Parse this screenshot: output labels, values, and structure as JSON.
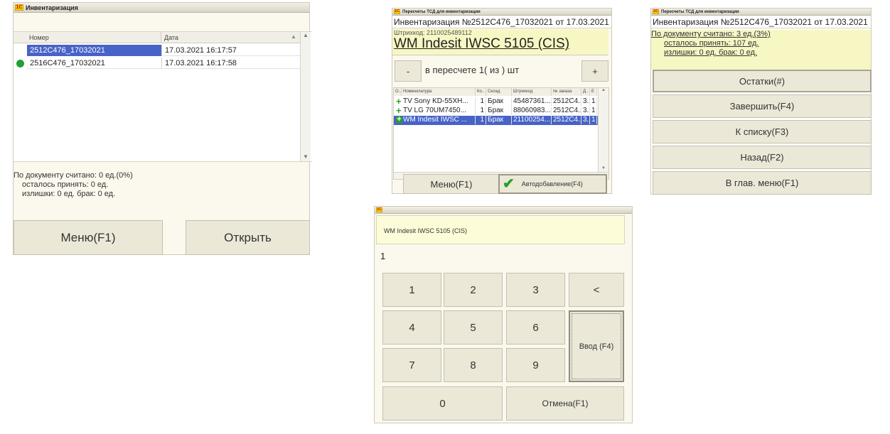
{
  "inv_list": {
    "title": "Инвентаризация",
    "columns": [
      "Номер",
      "Дата"
    ],
    "rows": [
      {
        "number": "2512C476_17032021",
        "date": "17.03.2021 16:17:57",
        "selected": true
      },
      {
        "number": "2516C476_17032021",
        "date": "17.03.2021 16:17:58",
        "selected": false
      }
    ],
    "stats": {
      "line1": "По документу считано: 0 ед.(0%)",
      "line2": "осталось принять: 0 ед.",
      "line3": "излишки: 0 ед.  брак: 0 ед."
    },
    "menu_label": "Меню(F1)",
    "open_label": "Открыть"
  },
  "recount": {
    "title": "Пересчеты ТСД для инвентаризации",
    "header": "Инвентаризация №2512C476_17032021 от 17.03.2021 ...",
    "barcode_label": "Штрихкод: 2110025489112",
    "product_name": "WM Indesit IWSC 5105 (CIS)",
    "minus_label": "-",
    "plus_label": "+",
    "counter_text": "в пересчете 1( из ) шт",
    "columns": [
      "О..",
      "Номенклатура",
      "Ко..",
      "Склад",
      "Штрихкод",
      "№ заказа",
      "Д..",
      "Е"
    ],
    "rows": [
      {
        "name": "TV Sony KD-55XH...",
        "qty": "1",
        "warehouse": "Брак",
        "barcode": "45487361...",
        "order": "2512C4...",
        "d": "3..",
        "e": "1",
        "selected": false
      },
      {
        "name": "TV LG 70UM7450...",
        "qty": "1",
        "warehouse": "Брак",
        "barcode": "88060983...",
        "order": "2512C4...",
        "d": "3..",
        "e": "1",
        "selected": false
      },
      {
        "name": "WM Indesit IWSC ...",
        "qty": "1",
        "warehouse": "Брак",
        "barcode": "21100254...",
        "order": "2512C4...",
        "d": "3..",
        "e": "1",
        "selected": true
      }
    ],
    "menu_label": "Меню(F1)",
    "autoadd_label": "Автодобавление(F4)"
  },
  "recount_menu": {
    "title": "Пересчеты ТСД для инвентаризации",
    "header": "Инвентаризация №2512C476_17032021 от 17.03.2021 ...",
    "stats": {
      "line1": "По документу считано: 3 ед.(3%)",
      "line2": "осталось принять: 107 ед.",
      "line3": "излишки: 0 ед.   брак: 0 ед."
    },
    "buttons": [
      "Остатки(#)",
      "Завершить(F4)",
      "К списку(F3)",
      "Назад(F2)",
      "В глав. меню(F1)"
    ]
  },
  "keypad": {
    "product_name": "WM Indesit IWSC 5105 (CIS)",
    "value": "1",
    "keys": [
      "1",
      "2",
      "3",
      "<",
      "4",
      "5",
      "6",
      "7",
      "8",
      "9",
      "0"
    ],
    "enter_label": "Ввод (F4)",
    "cancel_label": "Отмена(F1)"
  },
  "colors": {
    "selection": "#4763c7",
    "accent_yellow": "#f7f7c4",
    "button": "#ece8d8",
    "green": "#2b9e2b"
  },
  "icons": [
    "logo-1c-icon",
    "scroll-up-icon",
    "scroll-down-icon",
    "plus-icon",
    "checkmark-icon",
    "green-dot-icon"
  ]
}
